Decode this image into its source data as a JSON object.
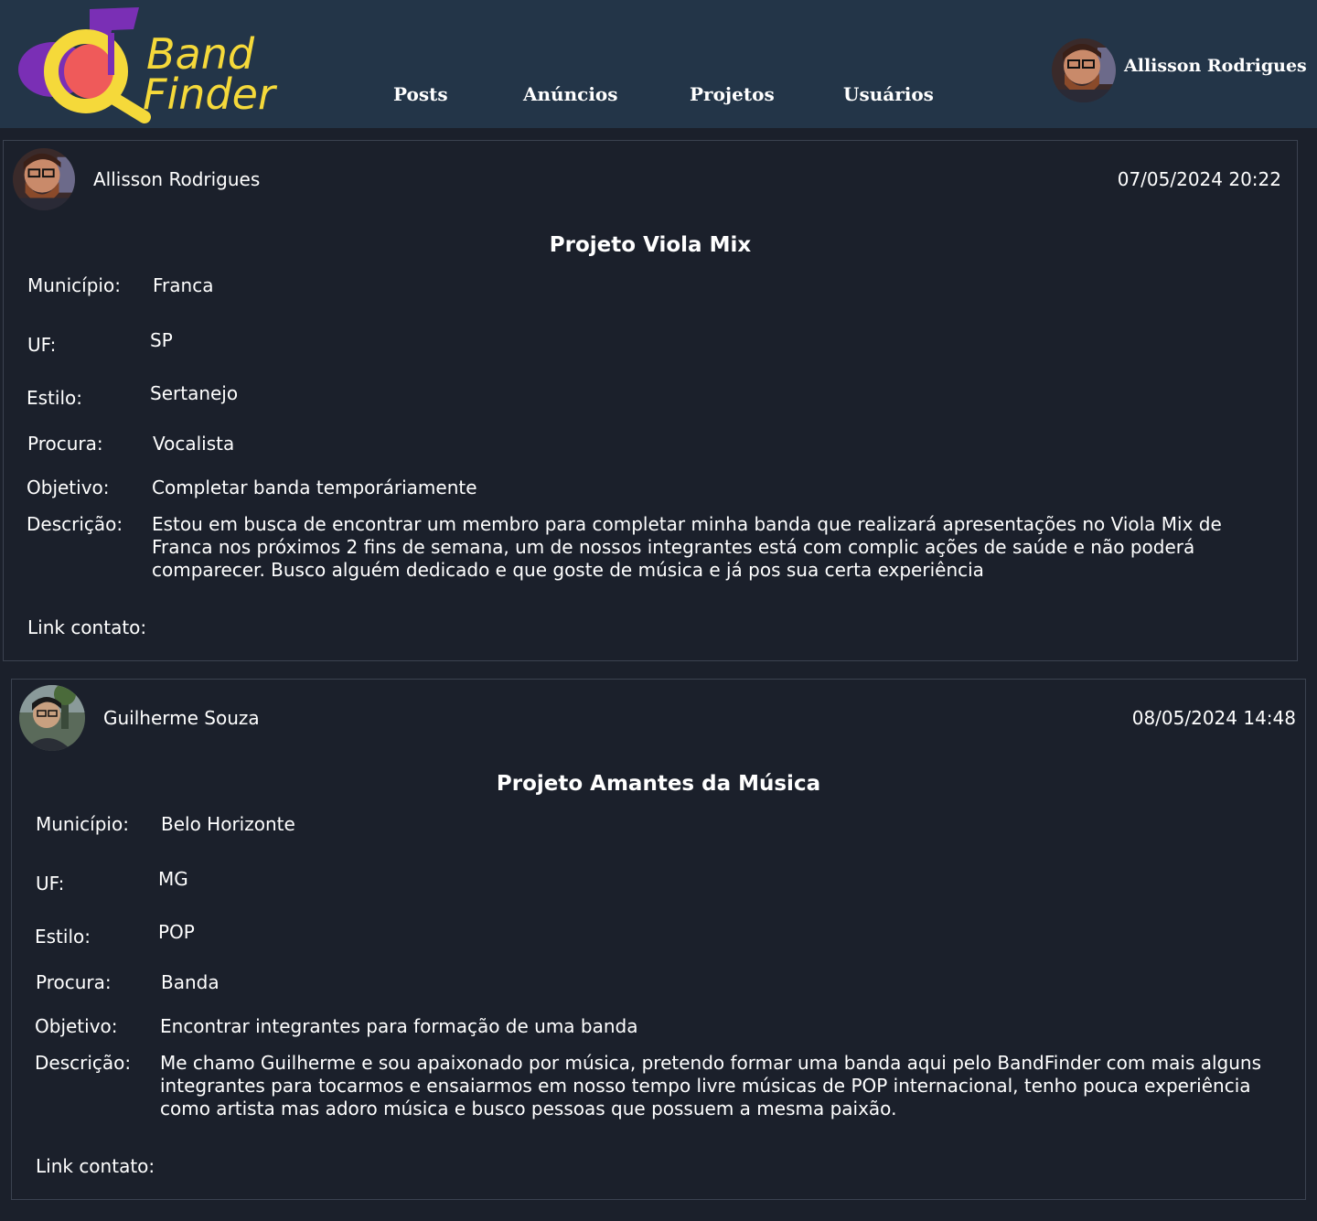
{
  "app": {
    "logo_line1": "Band",
    "logo_line2": "Finder",
    "brand_colors": {
      "header_bg": "#233548",
      "page_bg": "#1b202b",
      "logo_yellow": "#f5d93a",
      "logo_purple": "#7a2fb5",
      "logo_red": "#ef5a5a"
    }
  },
  "nav": {
    "items": [
      {
        "label": "Posts"
      },
      {
        "label": "Anúncios"
      },
      {
        "label": "Projetos"
      },
      {
        "label": "Usuários"
      }
    ]
  },
  "current_user": {
    "name": "Allisson Rodrigues",
    "avatar_icon": "user-avatar"
  },
  "labels": {
    "municipio": "Município:",
    "uf": "UF:",
    "estilo": "Estilo:",
    "procura": "Procura:",
    "objetivo": "Objetivo:",
    "descricao": "Descrição:",
    "link": "Link contato:"
  },
  "posts": [
    {
      "author": "Allisson Rodrigues",
      "date": "07/05/2024 20:22",
      "title": "Projeto Viola Mix",
      "municipio": "Franca",
      "uf": "SP",
      "estilo": "Sertanejo",
      "procura": "Vocalista",
      "objetivo": "Completar banda temporáriamente",
      "descricao": "Estou em busca de encontrar um membro para completar minha banda que realizará apresentações no Viola Mix de Franca nos próximos 2 fins de semana, um de nossos integrantes está com complic ações de saúde e não poderá comparecer. Busco alguém dedicado e que goste de música e já pos sua certa experiência",
      "link": ""
    },
    {
      "author": "Guilherme Souza",
      "date": "08/05/2024 14:48",
      "title": "Projeto Amantes da Música",
      "municipio": "Belo Horizonte",
      "uf": "MG",
      "estilo": "POP",
      "procura": "Banda",
      "objetivo": "Encontrar integrantes para formação de uma banda",
      "descricao": "Me chamo Guilherme e sou apaixonado por música, pretendo formar uma banda aqui pelo BandFinder com mais alguns integrantes para tocarmos e ensaiarmos em nosso tempo livre músicas de POP internacional, tenho pouca experiência como artista mas adoro música e busco pessoas que possuem a mesma  paixão.",
      "link": ""
    }
  ]
}
